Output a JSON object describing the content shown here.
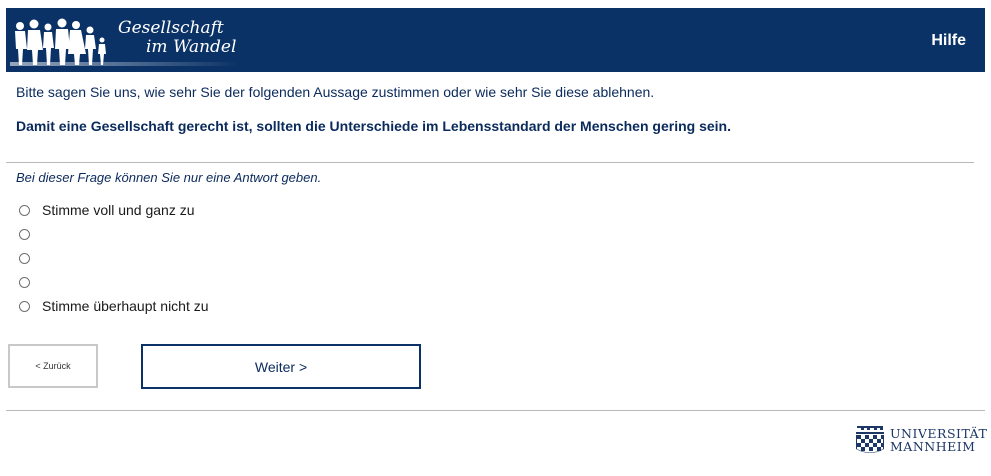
{
  "header": {
    "logo_line1": "Gesellschaft",
    "logo_line2": "im Wandel",
    "help_label": "Hilfe",
    "background_color": "#0b3266"
  },
  "question": {
    "intro": "Bitte sagen Sie uns, wie sehr Sie der folgenden Aussage zustimmen oder wie sehr Sie diese ablehnen.",
    "statement": "Damit eine Gesellschaft gerecht ist, sollten die Unterschiede im Lebensstandard der Menschen gering sein.",
    "hint": "Bei dieser Frage können Sie nur eine Antwort geben."
  },
  "options": [
    {
      "label": "Stimme voll und ganz zu",
      "selected": false
    },
    {
      "label": "",
      "selected": false
    },
    {
      "label": "",
      "selected": false
    },
    {
      "label": "",
      "selected": false
    },
    {
      "label": "Stimme überhaupt nicht zu",
      "selected": false
    }
  ],
  "navigation": {
    "back_label": "< Zurück",
    "next_label": "Weiter >"
  },
  "footer": {
    "university_line1": "UNIVERSITÄT",
    "university_line2": "MANNHEIM"
  }
}
